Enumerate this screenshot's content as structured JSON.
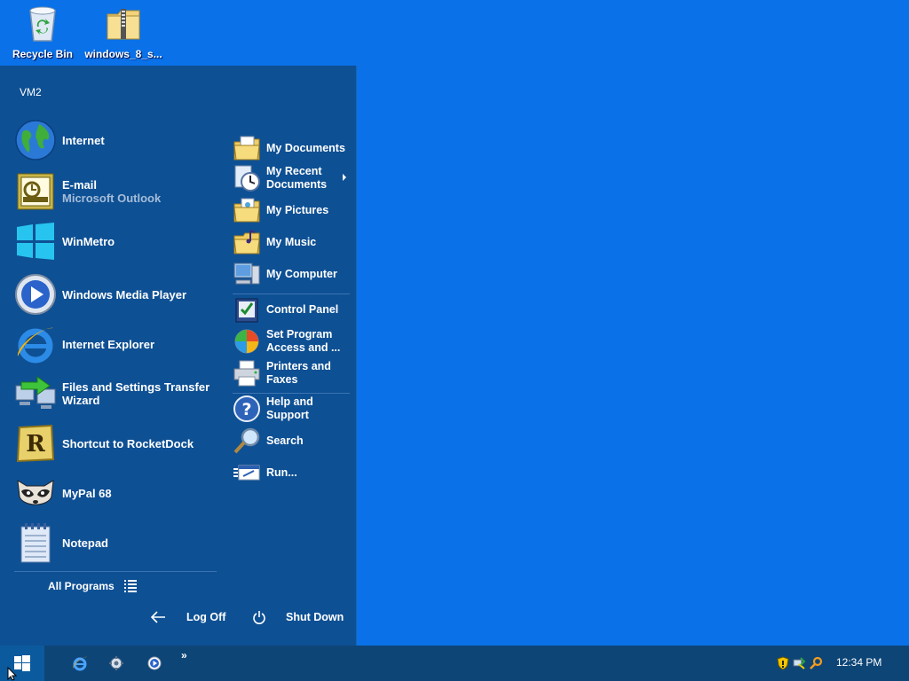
{
  "desktop": {
    "icons": [
      {
        "label": "Recycle Bin",
        "icon": "recycle-bin-icon"
      },
      {
        "label": "windows_8_s...",
        "icon": "zip-folder-icon"
      }
    ]
  },
  "start_menu": {
    "user": "VM2",
    "left_items": [
      {
        "label": "Internet",
        "icon": "globe-icon"
      },
      {
        "label": "E-mail",
        "sublabel": "Microsoft Outlook",
        "icon": "outlook-icon"
      },
      {
        "label": "WinMetro",
        "icon": "windows-logo-icon"
      },
      {
        "label": "Windows Media Player",
        "icon": "media-player-icon"
      },
      {
        "label": "Internet Explorer",
        "icon": "internet-explorer-icon"
      },
      {
        "label": "Files and Settings Transfer Wizard",
        "icon": "transfer-wizard-icon"
      },
      {
        "label": "Shortcut to RocketDock",
        "icon": "rocketdock-icon"
      },
      {
        "label": "MyPal 68",
        "icon": "mypal-raccoon-icon"
      },
      {
        "label": "Notepad",
        "icon": "notepad-icon"
      }
    ],
    "all_programs": "All Programs",
    "right_items": [
      {
        "label": "My Documents",
        "icon": "my-documents-icon"
      },
      {
        "label": "My Recent Documents",
        "icon": "recent-documents-icon"
      },
      {
        "label": "My Pictures",
        "icon": "my-pictures-icon"
      },
      {
        "label": "My Music",
        "icon": "my-music-icon"
      },
      {
        "label": "My Computer",
        "icon": "my-computer-icon"
      },
      {
        "label": "Control Panel",
        "icon": "control-panel-icon"
      },
      {
        "label": "Set Program Access and ...",
        "icon": "program-access-icon"
      },
      {
        "label": "Printers and Faxes",
        "icon": "printer-icon"
      },
      {
        "label": "Help and Support",
        "icon": "help-icon"
      },
      {
        "label": "Search",
        "icon": "search-icon"
      },
      {
        "label": "Run...",
        "icon": "run-icon"
      }
    ],
    "log_off": "Log Off",
    "shut_down": "Shut Down"
  },
  "taskbar": {
    "quick_launch": [
      "internet-explorer-icon",
      "settings-icon",
      "media-player-icon"
    ],
    "overflow": "»",
    "tray_icons": [
      "security-shield-icon",
      "network-icon",
      "search-tray-icon"
    ],
    "clock": "12:34 PM"
  },
  "colors": {
    "desktop": "#0a71e8",
    "start_menu": "#0e5094",
    "taskbar": "#0e4577"
  }
}
